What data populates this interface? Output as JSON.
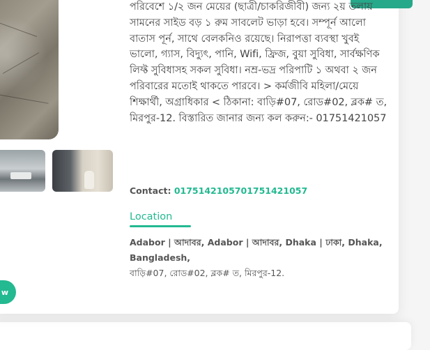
{
  "listing": {
    "description": "পরিবেশে ১/২ জন মেয়ের (ছাত্রী/চাকরিজীবী) জন্য ২য় তলায় সামনের সাইড বড় ১ রুম সাবলেট ভাড়া হবে। সম্পূর্ন আলো বাতাস পূর্ন, সাথে বেলকনিও রয়েছে। নিরাপত্তা ব্যবস্থা খুবই ভালো, গ্যাস, বিদ্যুৎ, পানি, Wifi, ফ্রিজ, বুয়া সুবিধা, সার্বক্ষণিক লিফ্ট সুবিধাসহ সকল সুবিধা। নম্র-ভদ্র পরিপাটি ১ অথবা ২ জন পরিবারের মতোই থাকতে পারবে। > কর্মজীবি মহিলা/মেয়ে শিক্ষার্থী, অগ্রাধিকার < ঠিকানা: বাড়ি#07, রোড#02, ব্লক# ত, মিরপুর-12. বিস্তারিত জানার জন্য কল করুন:- 01751421057",
    "contact_label": "Contact:",
    "contact_phone": "0175142105701751421057",
    "location_heading": "Location",
    "address_line": "Adabor | আদাবর, Adabor | আদাবর, Dhaka | ঢাকা, Dhaka, Bangladesh,",
    "street_address": "বাড়ি#07, রোড#02, ব্লক# ত, মিরপুর-12.",
    "view_button_label": "w"
  },
  "colors": {
    "accent": "#23b991",
    "text": "#444444"
  }
}
